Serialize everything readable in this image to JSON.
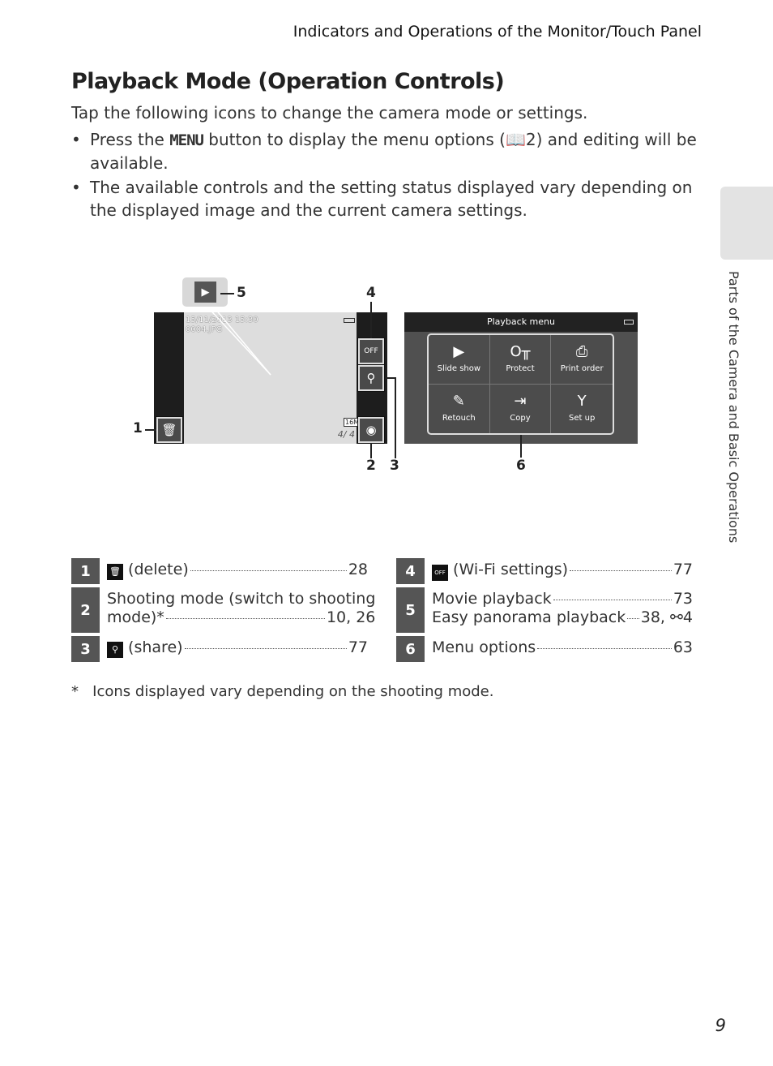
{
  "header": "Indicators and Operations of the Monitor/Touch Panel",
  "title": "Playback Mode (Operation Controls)",
  "intro": "Tap the following icons to change the camera mode or settings.",
  "bullets": [
    {
      "pre": "Press the ",
      "key": "MENU",
      "post": " button to display the menu options (",
      "ref": "2",
      "end": ") and editing will be available."
    },
    {
      "text": "The available controls and the setting status displayed vary depending on the displayed image and the current camera settings."
    }
  ],
  "side_tab": "Parts of the Camera and Basic Operations",
  "page_number": "9",
  "screen1": {
    "date": "15/11/2013 15:30",
    "file": "0004.JPG",
    "size": "16M",
    "counter": "4/ 4"
  },
  "screen2": {
    "title": "Playback menu",
    "items": [
      {
        "label": "Slide show",
        "icon": "slideshow-icon",
        "glyph": "▶"
      },
      {
        "label": "Protect",
        "icon": "key-icon",
        "glyph": "O╥"
      },
      {
        "label": "Print order",
        "icon": "printer-icon",
        "glyph": "⎙"
      },
      {
        "label": "Retouch",
        "icon": "retouch-icon",
        "glyph": "✎"
      },
      {
        "label": "Copy",
        "icon": "copy-icon",
        "glyph": "⇥"
      },
      {
        "label": "Set up",
        "icon": "wrench-icon",
        "glyph": "Y"
      }
    ]
  },
  "callouts": [
    "1",
    "2",
    "3",
    "4",
    "5",
    "6"
  ],
  "table_left": [
    {
      "num": "1",
      "icon": "trash-icon",
      "lines": [
        {
          "text": "(delete)",
          "page": "28"
        }
      ]
    },
    {
      "num": "2",
      "lines": [
        {
          "text": "Shooting mode (switch to shooting",
          "page": ""
        },
        {
          "text": "mode)*",
          "page": "10, 26"
        }
      ]
    },
    {
      "num": "3",
      "icon": "share-icon",
      "lines": [
        {
          "text": "(share)",
          "page": "77"
        }
      ]
    }
  ],
  "table_right": [
    {
      "num": "4",
      "icon": "wifi-off-icon",
      "lines": [
        {
          "text": "(Wi-Fi settings)",
          "page": "77"
        }
      ]
    },
    {
      "num": "5",
      "lines": [
        {
          "text": "Movie playback",
          "page": "73"
        },
        {
          "text": "Easy panorama playback",
          "page": "38, ⚯4"
        }
      ]
    },
    {
      "num": "6",
      "lines": [
        {
          "text": "Menu options",
          "page": "63"
        }
      ]
    }
  ],
  "footnote": "*   Icons displayed vary depending on the shooting mode."
}
